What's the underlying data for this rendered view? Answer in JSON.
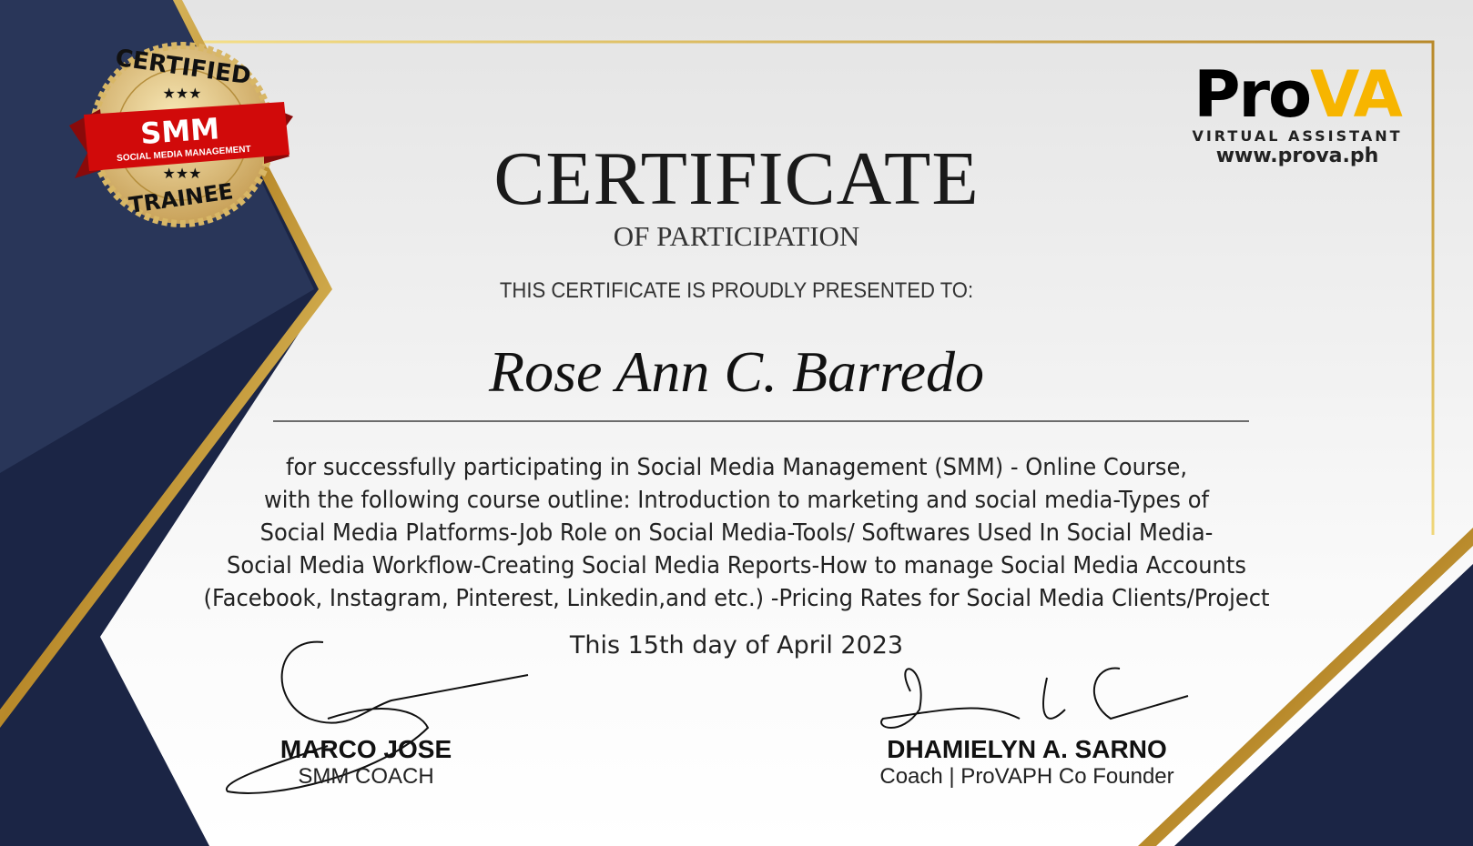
{
  "badge": {
    "top": "CERTIFIED",
    "main": "SMM",
    "ribbon": "SOCIAL MEDIA MANAGEMENT",
    "bottom": "TRAINEE"
  },
  "logo": {
    "brand_pro": "Pro",
    "brand_va": "VA",
    "tagline": "VIRTUAL ASSISTANT",
    "url": "www.prova.ph"
  },
  "certificate": {
    "title": "CERTIFICATE",
    "subtitle": "OF PARTICIPATION",
    "presented": "THIS CERTIFICATE IS PROUDLY PRESENTED TO:",
    "recipient": "Rose Ann C. Barredo",
    "body_lines": [
      "for successfully participating in Social Media Management (SMM) - Online Course,",
      "with the following course outline: Introduction to marketing and social media-Types of",
      "Social Media Platforms-Job Role on Social Media-Tools/ Softwares Used In Social Media-",
      "Social Media Workflow-Creating Social Media Reports-How to manage Social Media Accounts",
      "(Facebook, Instagram, Pinterest, Linkedin,and etc.) -Pricing Rates for Social Media Clients/Project"
    ],
    "date": "This 15th day of April 2023"
  },
  "signatories": [
    {
      "name": "MARCO JOSE",
      "role": "SMM COACH"
    },
    {
      "name": "DHAMIELYN A. SARNO",
      "role": "Coach | ProVAPH Co Founder"
    }
  ],
  "colors": {
    "navy": "#1b2545",
    "gold": "#c9a23a",
    "red": "#d10a0a",
    "accent": "#f7b500"
  }
}
